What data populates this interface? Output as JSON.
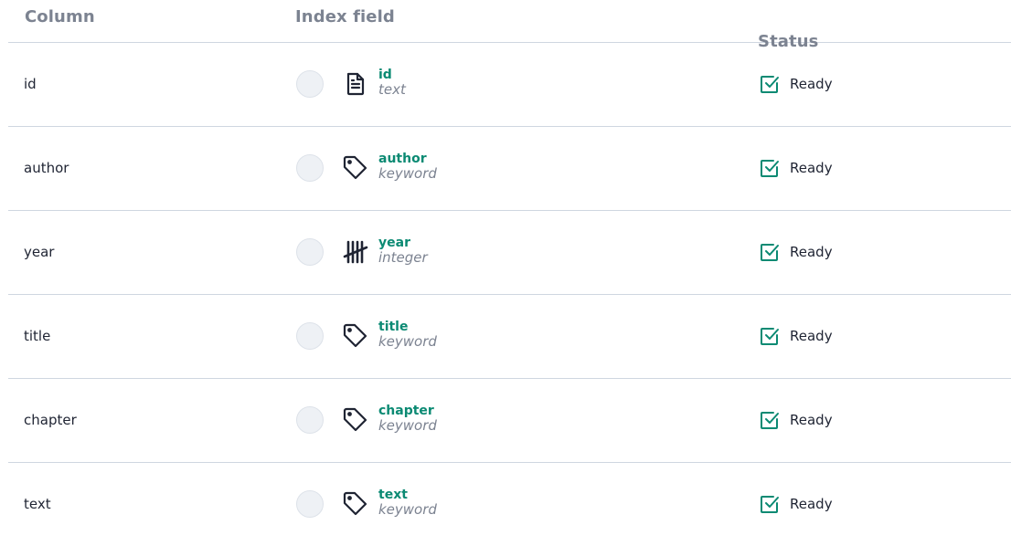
{
  "headers": {
    "column": "Column",
    "index_field": "Index field",
    "status": "Status"
  },
  "colors": {
    "accent": "#0b8a73",
    "muted": "#7c8391",
    "text": "#1f2433",
    "divider": "#cfd6e0"
  },
  "rows": [
    {
      "column": "id",
      "field_name": "id",
      "field_type": "text",
      "type_icon": "document-icon",
      "status": "Ready",
      "status_icon": "checkbox-checked-icon"
    },
    {
      "column": "author",
      "field_name": "author",
      "field_type": "keyword",
      "type_icon": "tag-icon",
      "status": "Ready",
      "status_icon": "checkbox-checked-icon"
    },
    {
      "column": "year",
      "field_name": "year",
      "field_type": "integer",
      "type_icon": "tally-icon",
      "status": "Ready",
      "status_icon": "checkbox-checked-icon"
    },
    {
      "column": "title",
      "field_name": "title",
      "field_type": "keyword",
      "type_icon": "tag-icon",
      "status": "Ready",
      "status_icon": "checkbox-checked-icon"
    },
    {
      "column": "chapter",
      "field_name": "chapter",
      "field_type": "keyword",
      "type_icon": "tag-icon",
      "status": "Ready",
      "status_icon": "checkbox-checked-icon"
    },
    {
      "column": "text",
      "field_name": "text",
      "field_type": "keyword",
      "type_icon": "tag-icon",
      "status": "Ready",
      "status_icon": "checkbox-checked-icon"
    }
  ]
}
